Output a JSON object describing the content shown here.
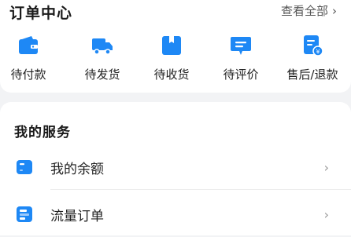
{
  "orders": {
    "title": "订单中心",
    "view_all": "查看全部",
    "items": [
      {
        "label": "待付款",
        "icon": "wallet-icon"
      },
      {
        "label": "待发货",
        "icon": "truck-icon"
      },
      {
        "label": "待收货",
        "icon": "package-icon"
      },
      {
        "label": "待评价",
        "icon": "comment-icon"
      },
      {
        "label": "售后/退款",
        "icon": "refund-icon"
      }
    ]
  },
  "services": {
    "title": "我的服务",
    "items": [
      {
        "label": "我的余额",
        "icon": "balance-card-icon"
      },
      {
        "label": "流量订单",
        "icon": "data-order-icon"
      }
    ]
  },
  "colors": {
    "accent": "#1e88f5",
    "background": "#f2f3f5"
  }
}
